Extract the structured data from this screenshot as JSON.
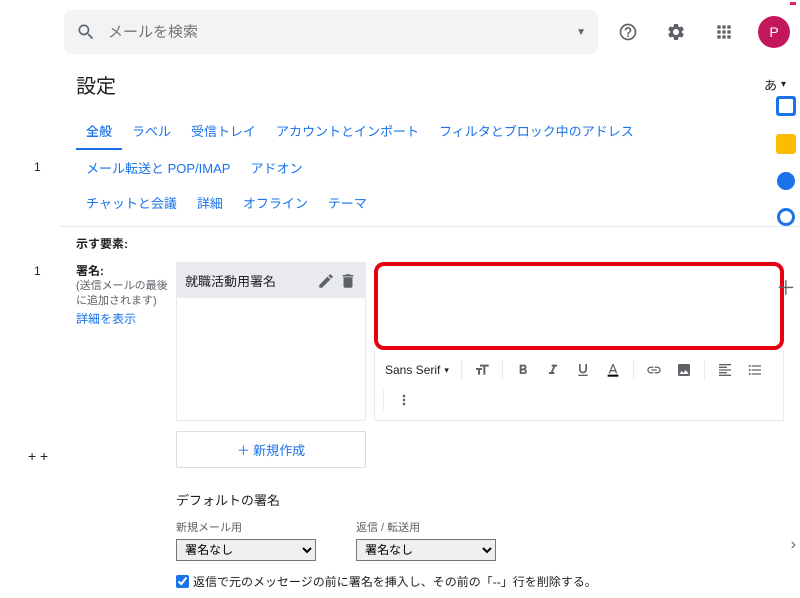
{
  "search": {
    "placeholder": "メールを検索"
  },
  "avatar": {
    "letter": "P"
  },
  "page": {
    "title": "設定",
    "lang": "あ"
  },
  "tabs": {
    "row1": [
      "全般",
      "ラベル",
      "受信トレイ",
      "アカウントとインポート",
      "フィルタとブロック中のアドレス",
      "メール転送と POP/IMAP",
      "アドオン"
    ],
    "row2": [
      "チャットと会議",
      "詳細",
      "オフライン",
      "テーマ"
    ],
    "active_index": 0
  },
  "content": {
    "prev_section_tail": "示す要素:",
    "signature": {
      "label": "署名:",
      "sublabel": "(送信メールの最後に追加されます)",
      "detail_link": "詳細を表示",
      "item_name": "就職活動用署名",
      "font": "Sans Serif",
      "new_button": "＋ 新規作成"
    },
    "defaults": {
      "title": "デフォルトの署名",
      "new_label": "新規メール用",
      "reply_label": "返信 / 転送用",
      "new_value": "署名なし",
      "reply_value": "署名なし"
    },
    "checkbox": {
      "checked": true,
      "label": "返信で元のメッセージの前に署名を挿入し、その前の「--」行を削除する。"
    }
  }
}
